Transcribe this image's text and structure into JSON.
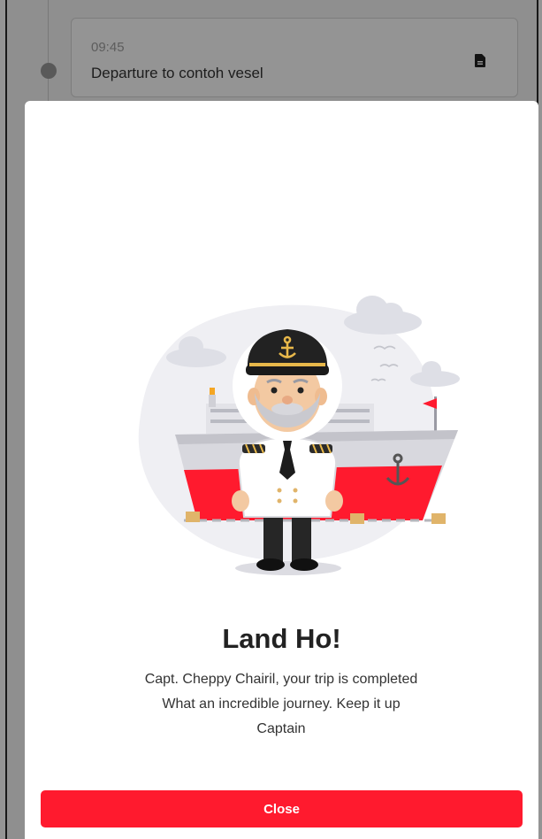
{
  "background": {
    "event": {
      "time": "09:45",
      "title": "Departure to contoh vesel",
      "icon": "document-icon"
    }
  },
  "modal": {
    "illustration": "captain-ship-illustration",
    "title": "Land Ho!",
    "message_line1": "Capt. Cheppy Chairil, your trip is completed",
    "message_line2": "What an incredible journey. Keep it up",
    "message_line3": "Captain",
    "close_label": "Close"
  },
  "colors": {
    "accent": "#ff1a2e",
    "overlay": "#00000066"
  }
}
